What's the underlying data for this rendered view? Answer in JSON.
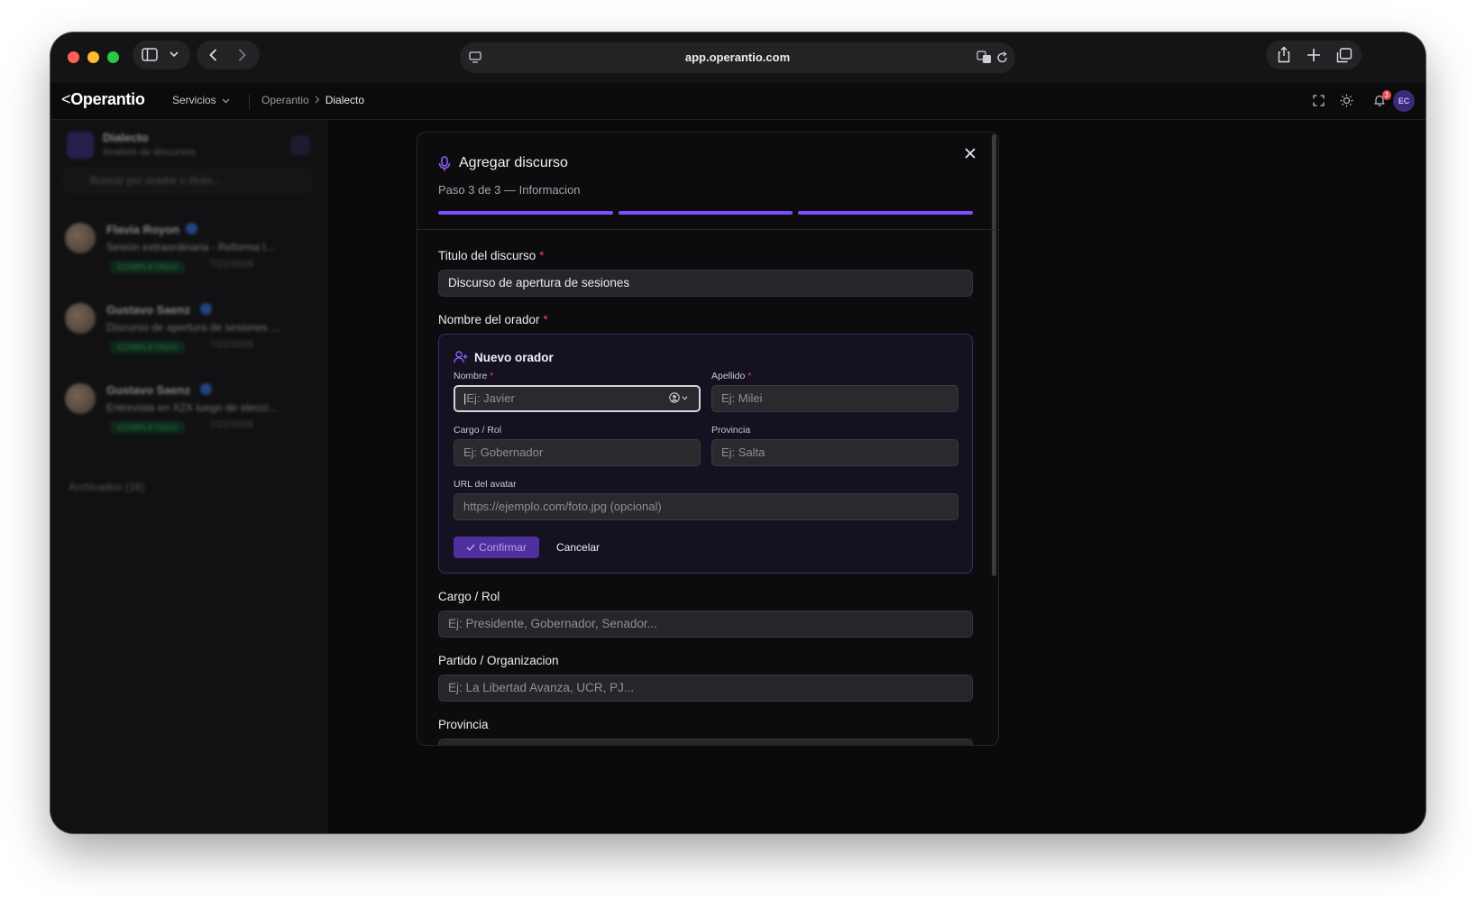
{
  "browser": {
    "url": "app.operantio.com"
  },
  "app": {
    "logo": "Operantio",
    "nav_services": "Servicios",
    "breadcrumb": [
      "Operantio",
      "Dialecto"
    ],
    "notifications_count": "3",
    "user_initials": "EC"
  },
  "sidebar": {
    "title": "Dialecto",
    "subtitle": "Analisis de discursos",
    "search_placeholder": "Buscar por orador o titulo...",
    "items": [
      {
        "name": "Flavia Royon",
        "desc": "Sesión extraordinaria - Reforma l...",
        "status": "COMPLETADO",
        "date": "7/22/2026"
      },
      {
        "name": "Gustavo Saenz",
        "desc": "Discurso de apertura de sesiones ...",
        "status": "COMPLETADO",
        "date": "7/22/2026"
      },
      {
        "name": "Gustavo Saenz",
        "desc": "Entrevista en X2X luego de elecci...",
        "status": "COMPLETADO",
        "date": "7/22/2026"
      }
    ],
    "archived_label": "Archivados (16)"
  },
  "modal": {
    "title": "Agregar discurso",
    "step": "Paso 3 de 3 — Informacion",
    "progress": [
      1,
      1,
      1
    ],
    "titulo_label": "Titulo del discurso",
    "titulo_value": "Discurso de apertura de sesiones",
    "orador_label": "Nombre del orador",
    "required_mark": "*",
    "new_speaker": {
      "title": "Nuevo orador",
      "nombre_label": "Nombre",
      "nombre_placeholder": "Ej: Javier",
      "apellido_label": "Apellido",
      "apellido_placeholder": "Ej: Milei",
      "cargo_label": "Cargo / Rol",
      "cargo_placeholder": "Ej: Gobernador",
      "provincia_label": "Provincia",
      "provincia_placeholder": "Ej: Salta",
      "avatar_label": "URL del avatar",
      "avatar_placeholder": "https://ejemplo.com/foto.jpg (opcional)",
      "confirm_label": "Confirmar",
      "cancel_label": "Cancelar"
    },
    "cargo_label": "Cargo / Rol",
    "cargo_placeholder": "Ej: Presidente, Gobernador, Senador...",
    "partido_label": "Partido / Organizacion",
    "partido_placeholder": "Ej: La Libertad Avanza, UCR, PJ...",
    "provincia_label": "Provincia"
  },
  "colors": {
    "accent": "#7c4dff",
    "required": "#ef4444"
  }
}
